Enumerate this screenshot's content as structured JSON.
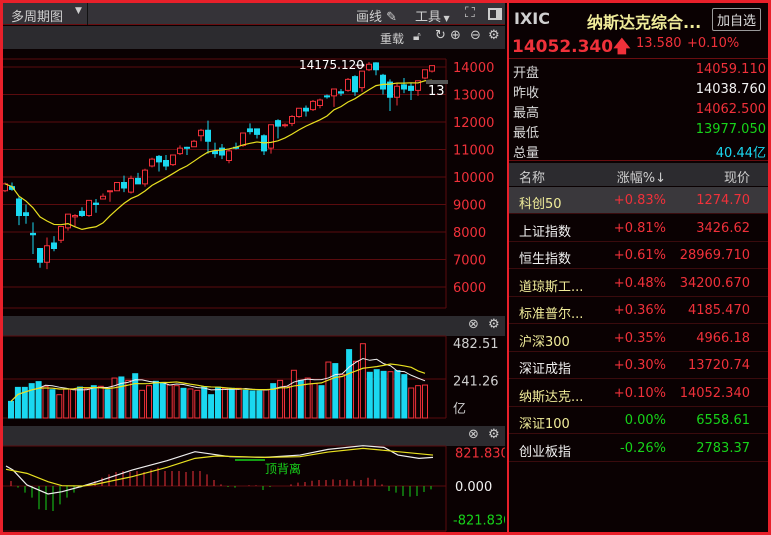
{
  "toolbar": {
    "period_label": "多周期图",
    "draw_label": "画线",
    "tools_label": "工具",
    "reload_label": "重载"
  },
  "price_chart": {
    "y_ticks": [
      "14000",
      "13000",
      "12000",
      "11000",
      "10000",
      "9000",
      "8000",
      "7000",
      "6000"
    ],
    "high_label": "14175.120",
    "current_tag": "13",
    "ma_color": "#e8e020",
    "up_color": "#f0313a",
    "down_color": "#1ad8f0"
  },
  "chart_data": [
    {
      "type": "candlestick",
      "ylim": [
        5500,
        14500
      ],
      "ohlc": [
        [
          9500,
          9800,
          9450,
          9750
        ],
        [
          9650,
          9800,
          9500,
          9550
        ],
        [
          9200,
          9300,
          8250,
          8600
        ],
        [
          8700,
          9000,
          8300,
          8600
        ],
        [
          7950,
          8350,
          7200,
          7900
        ],
        [
          7400,
          7400,
          6700,
          6900
        ],
        [
          6900,
          7800,
          6650,
          7500
        ],
        [
          7600,
          7850,
          7300,
          7400
        ],
        [
          7700,
          8200,
          7600,
          8200
        ],
        [
          8150,
          8650,
          8050,
          8650
        ],
        [
          8550,
          8650,
          8200,
          8600
        ],
        [
          8750,
          8900,
          8550,
          8600
        ],
        [
          8600,
          9150,
          8550,
          9150
        ],
        [
          9050,
          9200,
          8700,
          9000
        ],
        [
          9200,
          9400,
          9200,
          9300
        ],
        [
          9500,
          9500,
          9100,
          9500
        ],
        [
          9500,
          9800,
          9500,
          9800
        ],
        [
          9800,
          10050,
          9450,
          9600
        ],
        [
          9450,
          10050,
          9400,
          9950
        ],
        [
          9950,
          10150,
          9750,
          9750
        ],
        [
          9750,
          10300,
          9650,
          10250
        ],
        [
          10400,
          10700,
          10350,
          10650
        ],
        [
          10750,
          10800,
          10200,
          10550
        ],
        [
          10600,
          10800,
          10250,
          10400
        ],
        [
          10450,
          10800,
          10400,
          10800
        ],
        [
          10850,
          11150,
          10800,
          11050
        ],
        [
          11080,
          11100,
          10800,
          11050
        ],
        [
          11100,
          11350,
          11100,
          11300
        ],
        [
          11500,
          11750,
          11300,
          11700
        ],
        [
          11700,
          12050,
          10850,
          11300
        ],
        [
          10950,
          11250,
          10700,
          10850
        ],
        [
          11050,
          11200,
          10650,
          10800
        ],
        [
          10600,
          11000,
          10500,
          10950
        ],
        [
          11080,
          11250,
          11000,
          11050
        ],
        [
          11150,
          11600,
          11100,
          11600
        ],
        [
          11750,
          11950,
          11550,
          11650
        ],
        [
          11750,
          11750,
          11400,
          11550
        ],
        [
          11500,
          11550,
          10800,
          10950
        ],
        [
          11050,
          11900,
          10850,
          11900
        ],
        [
          12050,
          12100,
          11400,
          11850
        ],
        [
          11880,
          11950,
          11800,
          11900
        ],
        [
          11950,
          12250,
          11850,
          12200
        ],
        [
          12200,
          12500,
          12150,
          12500
        ],
        [
          12500,
          12600,
          12200,
          12400
        ],
        [
          12450,
          12800,
          12400,
          12750
        ],
        [
          12600,
          12850,
          12500,
          12800
        ],
        [
          12950,
          13000,
          12850,
          12930
        ],
        [
          12950,
          13200,
          12550,
          13200
        ],
        [
          13100,
          13200,
          12950,
          13050
        ],
        [
          13150,
          13600,
          13100,
          13550
        ],
        [
          13650,
          13700,
          12950,
          13100
        ],
        [
          13250,
          13850,
          13100,
          13850
        ],
        [
          13900,
          14175.12,
          13850,
          14100
        ],
        [
          14150,
          14175,
          13700,
          13900
        ],
        [
          13700,
          13750,
          13000,
          13200
        ],
        [
          13450,
          13550,
          12400,
          12900
        ],
        [
          12900,
          13400,
          12600,
          13300
        ],
        [
          13350,
          13600,
          13050,
          13200
        ],
        [
          13300,
          13400,
          12800,
          13150
        ],
        [
          13150,
          13500,
          12950,
          13500
        ],
        [
          13600,
          13900,
          13550,
          13900
        ],
        [
          13850,
          14060,
          13800,
          14050
        ]
      ]
    },
    {
      "type": "bar",
      "y_ticks": [
        "482.51",
        "241.26"
      ],
      "unit": "亿",
      "ylim": [
        0,
        482.51
      ],
      "values": [
        107,
        197,
        197,
        221,
        234,
        204,
        182,
        150,
        187,
        187,
        199,
        187,
        208,
        204,
        182,
        257,
        264,
        242,
        285,
        178,
        208,
        236,
        229,
        212,
        208,
        191,
        187,
        178,
        199,
        150,
        199,
        191,
        191,
        191,
        178,
        174,
        174,
        182,
        221,
        242,
        204,
        307,
        242,
        257,
        221,
        208,
        360,
        350,
        279,
        440,
        365,
        478,
        294,
        311,
        300,
        298,
        305,
        279,
        193,
        208,
        212
      ],
      "up": [
        0,
        0,
        0,
        0,
        0,
        1,
        0,
        1,
        1,
        1,
        0,
        1,
        0,
        1,
        0,
        1,
        0,
        1,
        0,
        1,
        1,
        0,
        0,
        1,
        1,
        0,
        1,
        1,
        0,
        0,
        0,
        1,
        0,
        1,
        0,
        0,
        0,
        1,
        0,
        1,
        1,
        1,
        0,
        1,
        1,
        0,
        1,
        0,
        1,
        0,
        1,
        1,
        0,
        0,
        0,
        1,
        0,
        0,
        1,
        1,
        1
      ]
    },
    {
      "type": "macd",
      "y_ticks": [
        "821.830",
        "0.000",
        "-821.830"
      ],
      "ylim": [
        -821.83,
        821.83
      ],
      "annotation": "顶背离",
      "hist": [
        123,
        -41,
        -164,
        -288,
        -575,
        -592,
        -616,
        -452,
        -288,
        -164,
        -41,
        41,
        123,
        205,
        288,
        345,
        370,
        345,
        370,
        345,
        411,
        452,
        370,
        370,
        370,
        345,
        370,
        370,
        288,
        148,
        41,
        -25,
        -41,
        0,
        16,
        16,
        -99,
        -25,
        0,
        0,
        41,
        82,
        99,
        131,
        148,
        148,
        164,
        148,
        164,
        131,
        148,
        205,
        164,
        41,
        -123,
        -164,
        -247,
        -263,
        -247,
        -148,
        -82
      ],
      "dif": [
        [
          0,
          493
        ],
        [
          1,
          394
        ],
        [
          3,
          25
        ],
        [
          6,
          -197
        ],
        [
          8,
          -140
        ],
        [
          11,
          0
        ],
        [
          13,
          107
        ],
        [
          18,
          394
        ],
        [
          23,
          625
        ],
        [
          27,
          847
        ],
        [
          32,
          723
        ],
        [
          37,
          707
        ],
        [
          42,
          764
        ],
        [
          46,
          904
        ],
        [
          51,
          995
        ],
        [
          54,
          953
        ],
        [
          56,
          764
        ],
        [
          59,
          682
        ],
        [
          61,
          707
        ]
      ],
      "dea": [
        [
          0,
          411
        ],
        [
          3,
          312
        ],
        [
          6,
          107
        ],
        [
          8,
          8
        ],
        [
          11,
          0
        ],
        [
          13,
          49
        ],
        [
          18,
          230
        ],
        [
          23,
          460
        ],
        [
          27,
          682
        ],
        [
          30,
          740
        ],
        [
          37,
          707
        ],
        [
          42,
          723
        ],
        [
          46,
          838
        ],
        [
          51,
          929
        ],
        [
          56,
          847
        ],
        [
          61,
          764
        ]
      ]
    }
  ],
  "quote": {
    "symbol": "IXIC",
    "name": "纳斯达克综合...",
    "add_watch": "加自选",
    "price": "14052.340",
    "change": "13.580",
    "change_pct": "+0.10%"
  },
  "stats": [
    {
      "label": "开盘",
      "value": "14059.110",
      "color": "red"
    },
    {
      "label": "昨收",
      "value": "14038.760",
      "color": "white"
    },
    {
      "label": "最高",
      "value": "14062.500",
      "color": "red"
    },
    {
      "label": "最低",
      "value": "13977.050",
      "color": "green"
    },
    {
      "label": "总量",
      "value": "40.44亿",
      "color": "cyan"
    }
  ],
  "table": {
    "headers": [
      "名称",
      "涨幅%↓",
      "现价"
    ],
    "rows": [
      {
        "name": "科创50",
        "pct": "+0.83%",
        "price": "1274.70",
        "nc": "yel",
        "c": "red"
      },
      {
        "name": "上证指数",
        "pct": "+0.81%",
        "price": "3426.62",
        "nc": "white",
        "c": "red"
      },
      {
        "name": "恒生指数",
        "pct": "+0.61%",
        "price": "28969.710",
        "nc": "white",
        "c": "red"
      },
      {
        "name": "道琼斯工...",
        "pct": "+0.48%",
        "price": "34200.670",
        "nc": "yel",
        "c": "red"
      },
      {
        "name": "标准普尔...",
        "pct": "+0.36%",
        "price": "4185.470",
        "nc": "yel",
        "c": "red"
      },
      {
        "name": "沪深300",
        "pct": "+0.35%",
        "price": "4966.18",
        "nc": "yel",
        "c": "red"
      },
      {
        "name": "深证成指",
        "pct": "+0.30%",
        "price": "13720.74",
        "nc": "white",
        "c": "red"
      },
      {
        "name": "纳斯达克...",
        "pct": "+0.10%",
        "price": "14052.340",
        "nc": "yel",
        "c": "red"
      },
      {
        "name": "深证100",
        "pct": "0.00%",
        "price": "6558.61",
        "nc": "yel",
        "c": "green"
      },
      {
        "name": "创业板指",
        "pct": "-0.26%",
        "price": "2783.37",
        "nc": "white",
        "c": "green"
      }
    ]
  }
}
